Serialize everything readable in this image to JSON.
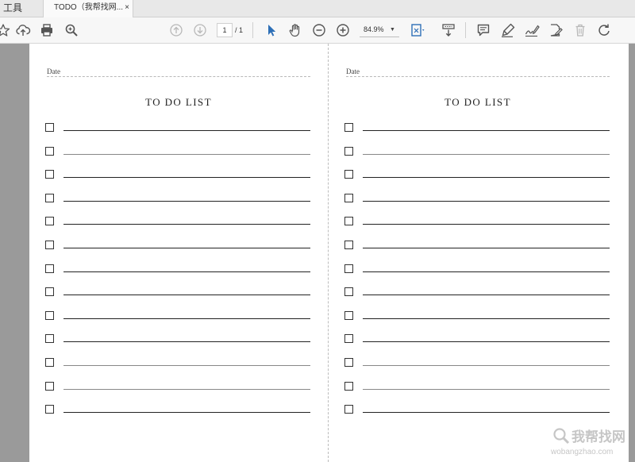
{
  "tabs": {
    "tools_label": "工具",
    "doc_title": "TODO（我帮找网...",
    "close_glyph": "×"
  },
  "toolbar": {
    "page_current": "1",
    "page_total": "/ 1",
    "zoom": "84.9%",
    "icons": [
      "star-icon",
      "upload-cloud-icon",
      "print-icon",
      "search-zoom-icon",
      "page-up-icon",
      "page-down-icon",
      "select-pointer-icon",
      "hand-tool-icon",
      "zoom-out-icon",
      "zoom-in-icon",
      "fit-page-icon",
      "scroll-mode-icon",
      "comment-icon",
      "highlighter-icon",
      "sign-icon",
      "edit-pdf-icon",
      "delete-icon",
      "rotate-icon"
    ],
    "accent_color": "#2d6fb7"
  },
  "document": {
    "pages": [
      {
        "date_label": "Date",
        "title": "TO DO LIST",
        "item_count": 13
      },
      {
        "date_label": "Date",
        "title": "TO DO LIST",
        "item_count": 13
      }
    ]
  },
  "watermark": {
    "text": "我帮找网",
    "url": "wobangzhao.com"
  }
}
